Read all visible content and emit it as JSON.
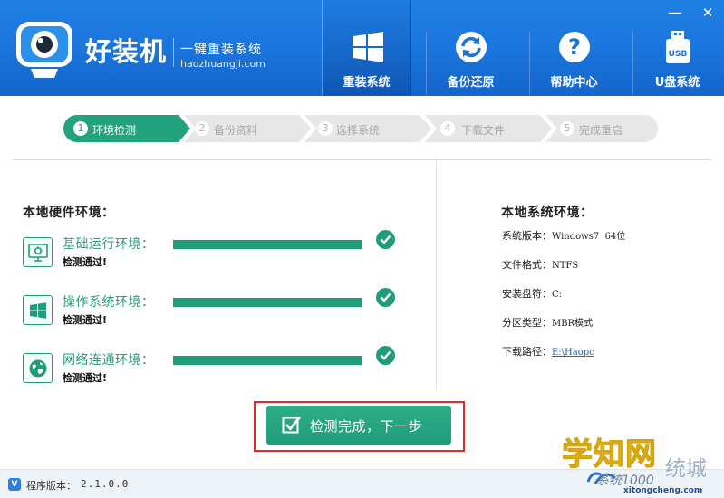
{
  "app": {
    "name": "好装机",
    "slogan": "一键重装系统",
    "domain": "haozhuangji.com",
    "window_minimize": "—",
    "window_close": "✕"
  },
  "nav": {
    "items": [
      {
        "label": "重装系统",
        "icon": "windows-logo-icon",
        "active": true
      },
      {
        "label": "备份还原",
        "icon": "sync-icon",
        "active": false
      },
      {
        "label": "帮助中心",
        "icon": "help-question-icon",
        "active": false
      },
      {
        "label": "U盘系统",
        "icon": "usb-drive-icon",
        "active": false
      }
    ],
    "usb_badge": "USB"
  },
  "steps": [
    {
      "num": "1",
      "label": "环境检测",
      "active": true
    },
    {
      "num": "2",
      "label": "备份资料",
      "active": false
    },
    {
      "num": "3",
      "label": "选择系统",
      "active": false
    },
    {
      "num": "4",
      "label": "下载文件",
      "active": false
    },
    {
      "num": "5",
      "label": "完成重启",
      "active": false
    }
  ],
  "hardware": {
    "title": "本地硬件环境：",
    "checks": [
      {
        "name": "基础运行环境：",
        "result": "检测通过!",
        "icon": "monitor-gear-icon",
        "progress": 1.0
      },
      {
        "name": "操作系统环境：",
        "result": "检测通过!",
        "icon": "windows-tile-icon",
        "progress": 1.0
      },
      {
        "name": "网络连通环境：",
        "result": "检测通过!",
        "icon": "globe-icon",
        "progress": 1.0
      }
    ]
  },
  "system": {
    "title": "本地系统环境：",
    "items": [
      {
        "label": "系统版本：",
        "value": "Windows7  64位"
      },
      {
        "label": "文件格式：",
        "value": "NTFS"
      },
      {
        "label": "安装盘符：",
        "value": "C:"
      },
      {
        "label": "分区类型：",
        "value": "MBR模式"
      },
      {
        "label": "下载路径：",
        "value": "E:\\Haopc",
        "link": true
      }
    ]
  },
  "action": {
    "next_label": "检测完成，下一步"
  },
  "footer": {
    "version_badge": "V",
    "version_label": "程序版本：",
    "version_value": "2.1.0.0"
  },
  "watermark": {
    "brand": "学知网",
    "sub": "统城",
    "logo_text": "系统1000",
    "url": "xitongcheng.com"
  },
  "colors": {
    "header_blue": "#1a74db",
    "accent_green": "#1f9c7a",
    "highlight_red": "#e12b2b",
    "watermark_gold": "#f0c319"
  }
}
